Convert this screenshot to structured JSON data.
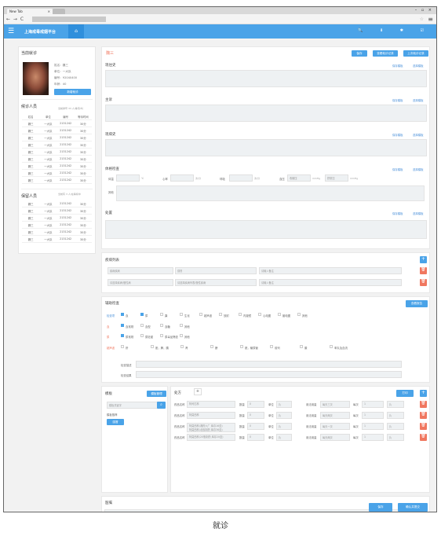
{
  "browser": {
    "tab_title": "New Tab",
    "tab_close": "×",
    "window_controls": "– ▫ ×",
    "nav_glyphs": "← → C",
    "star": "☆",
    "menu": "≡"
  },
  "app": {
    "title": "上海戒毒戒烟平台",
    "home": "⌂",
    "menu_glyph": "☰",
    "hdr_icons": "🔍 ⬇ ✱ ☑"
  },
  "left": {
    "current_title": "当前就诊",
    "patient": {
      "name": "姓名：魏三",
      "unit": "单位：一大队",
      "id": "编号：92040400",
      "age": "年龄：40"
    },
    "new_button": "新增就诊",
    "waiting": {
      "title": "候诊人员",
      "count": "当前排号 33 人/等待/叫",
      "headers": [
        "姓名",
        "单位",
        "编号",
        "等待时间"
      ],
      "rows": [
        [
          "魏三",
          "一大队",
          "2131242",
          "30分"
        ],
        [
          "魏三",
          "一大队",
          "2131242",
          "30分"
        ],
        [
          "魏三",
          "一大队",
          "2131242",
          "30分"
        ],
        [
          "魏三",
          "一大队",
          "2131242",
          "30分"
        ],
        [
          "魏三",
          "一大队",
          "2131242",
          "30分"
        ],
        [
          "魏三",
          "一大队",
          "2131242",
          "30分"
        ],
        [
          "魏三",
          "一大队",
          "2131242",
          "30分"
        ],
        [
          "魏三",
          "一大队",
          "2131242",
          "30分"
        ],
        [
          "魏三",
          "一大队",
          "2131242",
          "30分"
        ]
      ]
    },
    "detained": {
      "title": "保留人员",
      "count": "当前有 3 人/在等候中",
      "rows": [
        [
          "魏三",
          "一大队",
          "2131242",
          "30分"
        ],
        [
          "魏三",
          "一大队",
          "2131242",
          "30分"
        ],
        [
          "魏三",
          "一大队",
          "2131242",
          "30分"
        ],
        [
          "魏三",
          "一大队",
          "2131242",
          "30分"
        ],
        [
          "魏三",
          "一大队",
          "2131242",
          "30分"
        ],
        [
          "魏三",
          "一大队",
          "2131242",
          "30分"
        ]
      ]
    }
  },
  "right": {
    "patient_name": "魏三",
    "top_buttons": [
      "保存",
      "查看就诊记录",
      "上次就诊记录"
    ],
    "save_tpl": "保存模板",
    "pick_tpl": "选择模板",
    "sections": {
      "history": "现往史",
      "complaint": "主诉",
      "present": "现病史",
      "exam": "体格检查",
      "disposal": "处置"
    },
    "exam": {
      "temp": "体温",
      "temp_unit": "℃",
      "hr": "心率",
      "hr_unit": "次/分",
      "resp": "呼吸",
      "resp_unit": "次/分",
      "bp": "血压",
      "bp_hi": "收缩压",
      "bp_unit": "mmHg",
      "bp_lo": "舒张压",
      "other": "其他"
    },
    "diagnosis": {
      "title": "疾病列表",
      "type": "疾病疾病",
      "disease": "感冒",
      "note": "请输入备注",
      "type2": "请选择疾病/慢性病",
      "disease2": "请选择疾病列表/慢性疾病",
      "note2": "请输入备注"
    },
    "aux": {
      "title": "辅助检查",
      "btn": "查看报告",
      "row1_label": "检查项",
      "row1": [
        "血",
        "尿",
        "粪",
        "生化",
        "超声波",
        "放射",
        "内窥镜",
        "心电图",
        "脑电图",
        "其他"
      ],
      "row2_label": "血",
      "row2": [
        "血常规",
        "血型",
        "血糖",
        "其他"
      ],
      "row3_label": "尿",
      "row3": [
        "尿常规",
        "尿妊娠",
        "尿毒品筛查",
        "其他"
      ],
      "row4_label": "超声波",
      "row4": [
        "肝",
        "胆，脾，胰",
        "肾",
        "膀",
        "胱，输尿管",
        "前列",
        "腺",
        "睾丸及血流"
      ],
      "other_desc": "检查描述",
      "result": "检查结果"
    },
    "template": {
      "title": "模板",
      "manage": "模板管理",
      "search": "模板关键字",
      "hint": "模板推荐",
      "tag": "感冒"
    },
    "rx": {
      "tab": "处方",
      "add_tab": "+",
      "print": "打印",
      "drug": "药品名称",
      "qty": "数量",
      "unit": "单位",
      "usage": "用法用量",
      "freq": "每次",
      "rows": [
        {
          "name": "阿司匹林",
          "q": "0",
          "u": "片",
          "use": "每天三次",
          "f": "1",
          "fu": "片"
        },
        {
          "name": "阿莫西林",
          "q": "0",
          "u": "片",
          "use": "每天两次",
          "f": "1",
          "fu": "片"
        },
        {
          "name": "阿莫西林(湘药六厂 库存16盒)",
          "name2": "阿莫西林(北极制药 库存36盒)",
          "q": "0",
          "u": "片",
          "use": "每天一次",
          "f": "1",
          "fu": "片"
        },
        {
          "name": "阿莫西林(20瓶制药 库存20盒)",
          "q": "0",
          "u": "片",
          "use": "每天两次",
          "f": "1",
          "fu": "片"
        }
      ]
    },
    "advice": "医嘱",
    "bottom": {
      "save": "保存",
      "submit": "确认并提交"
    }
  },
  "caption": "就诊"
}
